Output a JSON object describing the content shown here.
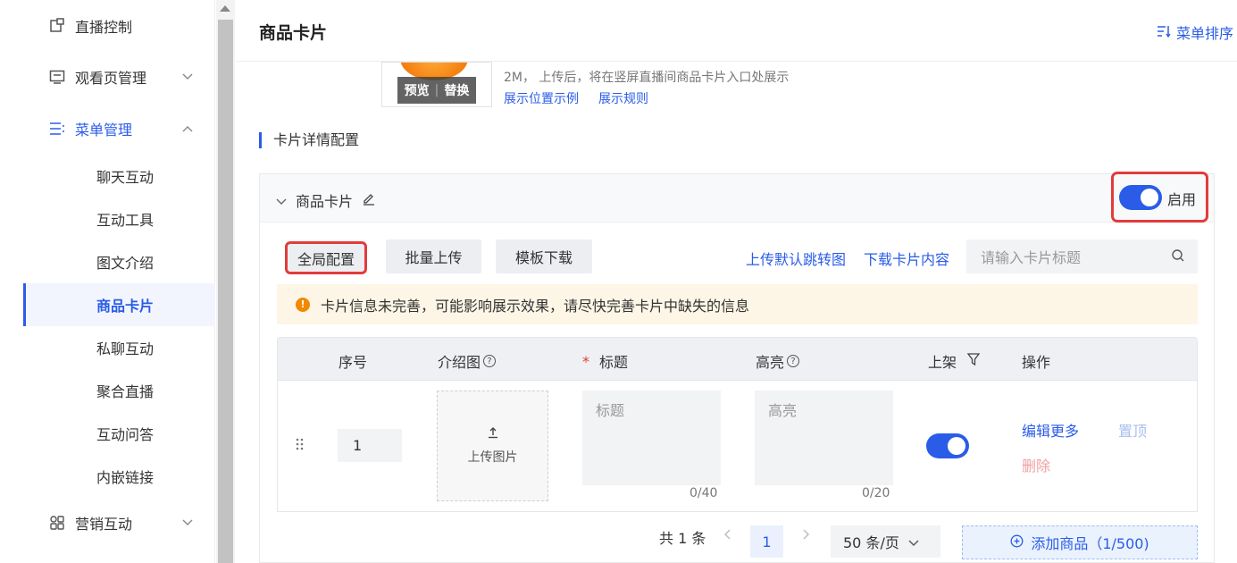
{
  "sidebar": {
    "top_item": "直播控制",
    "watch_page": "观看页管理",
    "menu_manage": "菜单管理",
    "sub_items": [
      "聊天互动",
      "互动工具",
      "图文介绍",
      "商品卡片",
      "私聊互动",
      "聚合直播",
      "互动问答",
      "内嵌链接"
    ],
    "active_sub": "商品卡片",
    "marketing": "营销互动"
  },
  "header": {
    "title": "商品卡片",
    "sort_label": "菜单排序"
  },
  "cover": {
    "preview_label": "预览",
    "replace_label": "替换",
    "info_text": "2M， 上传后，将在竖屏直播间商品卡片入口处展示",
    "link_example": "展示位置示例",
    "link_rules": "展示规则"
  },
  "section": {
    "title": "卡片详情配置"
  },
  "panel": {
    "title": "商品卡片",
    "enable_label": "启用",
    "enabled": true
  },
  "toolbar": {
    "global_config": "全局配置",
    "batch_upload": "批量上传",
    "template_download": "模板下载",
    "upload_default_jump": "上传默认跳转图",
    "download_card_content": "下载卡片内容",
    "search_placeholder": "请输入卡片标题"
  },
  "warning": {
    "text": "卡片信息未完善，可能影响展示效果，请尽快完善卡片中缺失的信息"
  },
  "table": {
    "headers": {
      "seq": "序号",
      "intro_image": "介绍图",
      "required_mark": "*",
      "title": "标题",
      "highlight": "高亮",
      "on_shelf": "上架",
      "actions": "操作"
    },
    "rows": [
      {
        "seq": "1",
        "upload_label": "上传图片",
        "title_placeholder": "标题",
        "title_count": "0/40",
        "highlight_placeholder": "高亮",
        "highlight_count": "0/20",
        "on_shelf": true,
        "edit_more": "编辑更多",
        "pin_top": "置顶",
        "delete": "删除"
      }
    ]
  },
  "pagination": {
    "total_prefix": "共",
    "total": "1",
    "total_suffix": "条",
    "current_page": "1",
    "page_size": "50 条/页",
    "add_button": "添加商品（1/500)"
  },
  "colors": {
    "accent": "#2a5ce8",
    "highlight_box": "#e23b3b",
    "warning_bg": "#fdf6e6",
    "warning_icon": "#f08a00"
  }
}
